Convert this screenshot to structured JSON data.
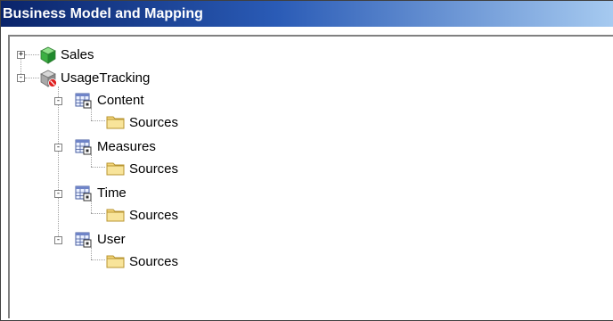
{
  "window": {
    "title": "Business Model and Mapping"
  },
  "tree": {
    "items": [
      {
        "label": "Sales",
        "icon": "green-cube-icon"
      },
      {
        "label": "UsageTracking",
        "icon": "gray-cube-error-icon",
        "children": [
          {
            "label": "Content",
            "icon": "logical-table-icon",
            "children": [
              {
                "label": "Sources",
                "icon": "folder-icon"
              }
            ]
          },
          {
            "label": "Measures",
            "icon": "logical-table-icon",
            "children": [
              {
                "label": "Sources",
                "icon": "folder-icon"
              }
            ]
          },
          {
            "label": "Time",
            "icon": "logical-table-icon",
            "children": [
              {
                "label": "Sources",
                "icon": "folder-icon"
              }
            ]
          },
          {
            "label": "User",
            "icon": "logical-table-icon",
            "children": [
              {
                "label": "Sources",
                "icon": "folder-icon"
              }
            ]
          }
        ]
      }
    ]
  }
}
